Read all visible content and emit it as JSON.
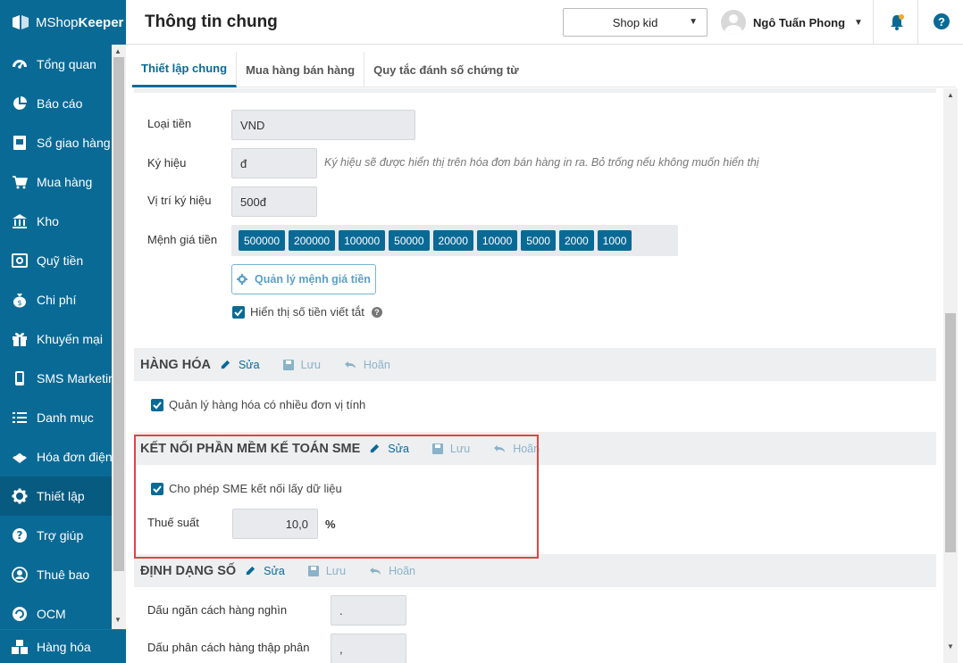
{
  "app": {
    "brand_pre": "MShop",
    "brand_bold": "Keeper"
  },
  "header": {
    "title": "Thông tin chung",
    "shop": "Shop kid",
    "user": "Ngô Tuấn Phong"
  },
  "sidebar": {
    "items": [
      {
        "label": "Tổng quan",
        "icon": "dashboard-icon"
      },
      {
        "label": "Báo cáo",
        "icon": "pie-chart-icon"
      },
      {
        "label": "Sổ giao hàng",
        "icon": "delivery-book-icon"
      },
      {
        "label": "Mua hàng",
        "icon": "cart-icon"
      },
      {
        "label": "Kho",
        "icon": "warehouse-icon"
      },
      {
        "label": "Quỹ tiền",
        "icon": "safe-icon"
      },
      {
        "label": "Chi phí",
        "icon": "money-bag-icon"
      },
      {
        "label": "Khuyến mại",
        "icon": "gift-icon"
      },
      {
        "label": "SMS Marketing",
        "icon": "phone-icon"
      },
      {
        "label": "Danh mục",
        "icon": "list-icon"
      },
      {
        "label": "Hóa đơn điện tử",
        "icon": "invoice-icon"
      },
      {
        "label": "Thiết lập",
        "icon": "gear-icon"
      },
      {
        "label": "Trợ giúp",
        "icon": "help-icon"
      },
      {
        "label": "Thuê bao",
        "icon": "user-icon"
      },
      {
        "label": "OCM",
        "icon": "ocm-icon"
      }
    ],
    "bottom": "Hàng hóa"
  },
  "tabs": [
    "Thiết lập chung",
    "Mua hàng bán hàng",
    "Quy tắc đánh số chứng từ"
  ],
  "currency": {
    "type_label": "Loại tiền",
    "type_value": "VND",
    "symbol_label": "Ký hiệu",
    "symbol_value": "đ",
    "symbol_hint": "Ký hiệu sẽ được hiển thị trên hóa đơn bán hàng in ra. Bỏ trống nếu không muốn hiển thị",
    "position_label": "Vị trí ký hiệu",
    "position_value": "500đ",
    "denom_label": "Mệnh giá tiền",
    "denominations": [
      "500000",
      "200000",
      "100000",
      "50000",
      "20000",
      "10000",
      "5000",
      "2000",
      "1000"
    ],
    "manage_button": "Quản lý mệnh giá tiền",
    "short_amount": "Hiển thị số tiền viết tắt"
  },
  "actions": {
    "edit": "Sửa",
    "save": "Lưu",
    "cancel": "Hoãn"
  },
  "goods": {
    "title": "HÀNG HÓA",
    "multi_unit": "Quản lý hàng hóa có nhiều đơn vị tính"
  },
  "sme": {
    "title": "KẾT NỐI PHẦN MỀM KẾ TOÁN SME",
    "allow": "Cho phép SME kết nối lấy dữ liệu",
    "tax_label": "Thuế suất",
    "tax_value": "10,0",
    "tax_unit": "%"
  },
  "number_format": {
    "title": "ĐỊNH DẠNG SỐ",
    "thousand_label": "Dấu ngăn cách hàng nghìn",
    "thousand_value": ".",
    "decimal_label": "Dấu phân cách hàng thập phân",
    "decimal_value": ","
  }
}
